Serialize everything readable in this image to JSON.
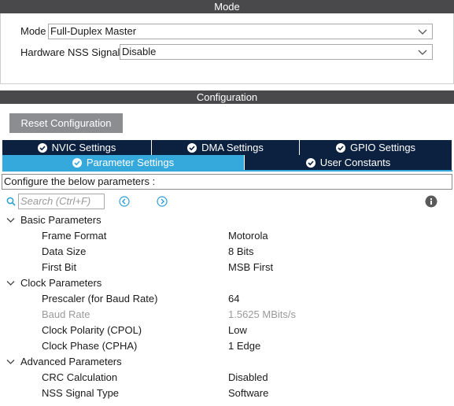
{
  "mode": {
    "header": "Mode",
    "mode_label": "Mode",
    "mode_value": "Full-Duplex Master",
    "nss_label": "Hardware NSS Signal",
    "nss_value": "Disable"
  },
  "configuration": {
    "header": "Configuration",
    "reset_button": "Reset Configuration",
    "tabs": [
      {
        "label": "NVIC Settings"
      },
      {
        "label": "DMA Settings"
      },
      {
        "label": "GPIO Settings"
      },
      {
        "label": "Parameter Settings",
        "active": true
      },
      {
        "label": "User Constants"
      }
    ],
    "description": "Configure the below parameters :",
    "search_placeholder": "Search (Ctrl+F)"
  },
  "parameters": {
    "basic": {
      "title": "Basic Parameters",
      "items": [
        {
          "label": "Frame Format",
          "value": "Motorola"
        },
        {
          "label": "Data Size",
          "value": "8 Bits"
        },
        {
          "label": "First Bit",
          "value": "MSB First"
        }
      ]
    },
    "clock": {
      "title": "Clock Parameters",
      "items": [
        {
          "label": "Prescaler (for Baud Rate)",
          "value": "64"
        },
        {
          "label": "Baud Rate",
          "value": "1.5625 MBits/s",
          "disabled": true
        },
        {
          "label": "Clock Polarity (CPOL)",
          "value": "Low"
        },
        {
          "label": "Clock Phase (CPHA)",
          "value": "1 Edge"
        }
      ]
    },
    "advanced": {
      "title": "Advanced Parameters",
      "items": [
        {
          "label": "CRC Calculation",
          "value": "Disabled"
        },
        {
          "label": "NSS Signal Type",
          "value": "Software"
        }
      ]
    }
  },
  "colors": {
    "header_bg": "#49494b",
    "tab_dark": "#0c2140",
    "tab_active": "#35a8dc",
    "nav_arrow": "#2a9fd6"
  }
}
